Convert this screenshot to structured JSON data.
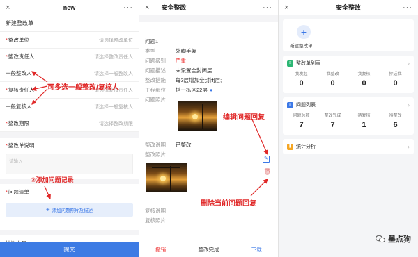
{
  "panel1": {
    "close_icon": "×",
    "title": "new",
    "more_icon": "···",
    "form_title": "新建整改单",
    "fields": [
      {
        "label": "整改单位",
        "required": true,
        "placeholder": "请选择整改单位"
      },
      {
        "label": "整改责任人",
        "required": true,
        "placeholder": "请选择整改责任人"
      },
      {
        "label": "一般整改人",
        "required": false,
        "placeholder": "请选择一般整改人"
      },
      {
        "label": "复核责任人",
        "required": true,
        "placeholder": "请选择复核责任人"
      },
      {
        "label": "一般复核人",
        "required": false,
        "placeholder": "请选择一般复核人"
      },
      {
        "label": "整改期限",
        "required": true,
        "placeholder": "请选择整改期限"
      }
    ],
    "desc_label": "整改单说明",
    "desc_placeholder": "请输入",
    "issue_list_label": "问题清单",
    "add_issue_label": "添加问题照片及描述",
    "cc_label": "抄送人员",
    "submit_label": "提交"
  },
  "panel2": {
    "close_icon": "×",
    "title": "安全整改",
    "more_icon": "···",
    "issue_heading": "问题1",
    "details": [
      {
        "k": "类型",
        "v": "外脚手架"
      },
      {
        "k": "问题级别",
        "v": "严重",
        "red": true
      },
      {
        "k": "问题描述",
        "v": "未设置全封闭层"
      },
      {
        "k": "整改措施",
        "v": "每3层增加全封闭层;"
      },
      {
        "k": "工程部位",
        "v": "塔一栋区22层"
      },
      {
        "k": "问题照片",
        "v": ""
      }
    ],
    "rect_desc_k": "整改说明",
    "rect_desc_v": "已整改",
    "rect_photo_k": "整改照片",
    "review_desc_k": "复核说明",
    "review_photo_k": "复核照片",
    "footer": {
      "revoke": "撤销",
      "done": "整改完成",
      "download": "下载"
    }
  },
  "panel3": {
    "close_icon": "×",
    "title": "安全整改",
    "more_icon": "···",
    "new_label": "新建整改单",
    "list1": {
      "title": "整改单列表",
      "icon_color": "#2bb673",
      "stats": [
        {
          "name": "我发起",
          "value": "0"
        },
        {
          "name": "我整改",
          "value": "0"
        },
        {
          "name": "我复核",
          "value": "0"
        },
        {
          "name": "抄送我",
          "value": "0"
        }
      ]
    },
    "list2": {
      "title": "问题列表",
      "icon_color": "#3b78e7",
      "stats": [
        {
          "name": "问题总数",
          "value": "7"
        },
        {
          "name": "整改完成",
          "value": "7"
        },
        {
          "name": "待复核",
          "value": "1"
        },
        {
          "name": "待整改",
          "value": "6"
        }
      ]
    },
    "stats_title": "统计分析",
    "stats_icon_color": "#f5a623"
  },
  "annotations": {
    "multi_select": "可多选一般整改/复核人",
    "add_record": "②添加问题记录",
    "edit_reply": "编辑问题回复",
    "delete_reply": "删除当前问题回复"
  },
  "watermark": "墨点狗"
}
